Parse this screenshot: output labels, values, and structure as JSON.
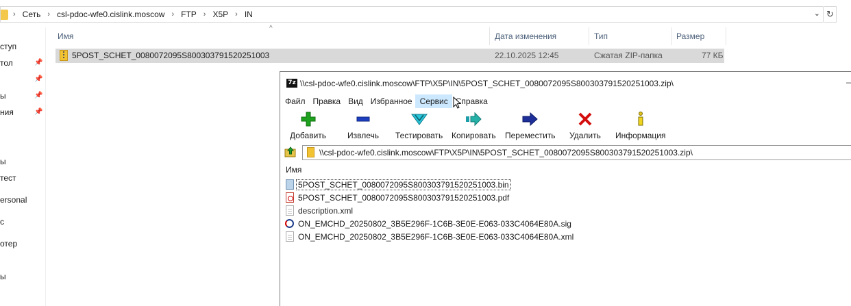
{
  "explorer": {
    "breadcrumbs": [
      "Сеть",
      "csl-pdoc-wfe0.cislink.moscow",
      "FTP",
      "X5P",
      "IN"
    ],
    "columns": {
      "name": "Имя",
      "modified": "Дата изменения",
      "type": "Тип",
      "size": "Размер"
    },
    "nav_items": [
      "ступ",
      "тол",
      "ы",
      "ния",
      "ы",
      "тест",
      "ersonal",
      "с",
      "отер",
      "ы"
    ],
    "file": {
      "name": "5POST_SCHET_0080072095S800303791520251003",
      "modified": "22.10.2025 12:45",
      "type": "Сжатая ZIP-папка",
      "size": "77 КБ"
    }
  },
  "sevenzip": {
    "title": "\\\\csl-pdoc-wfe0.cislink.moscow\\FTP\\X5P\\IN\\5POST_SCHET_0080072095S800303791520251003.zip\\",
    "logo": "7z",
    "menu": [
      "Файл",
      "Правка",
      "Вид",
      "Избранное",
      "Сервис",
      "Справка"
    ],
    "toolbar": [
      "Добавить",
      "Извлечь",
      "Тестировать",
      "Копировать",
      "Переместить",
      "Удалить",
      "Информация"
    ],
    "path": "\\\\csl-pdoc-wfe0.cislink.moscow\\FTP\\X5P\\IN\\5POST_SCHET_0080072095S800303791520251003.zip\\",
    "list_header": "Имя",
    "files": [
      {
        "name": "5POST_SCHET_0080072095S800303791520251003.bin",
        "icon": "bin-file-icon"
      },
      {
        "name": "5POST_SCHET_0080072095S800303791520251003.pdf",
        "icon": "pdf-file-icon"
      },
      {
        "name": "description.xml",
        "icon": "xml-file-icon"
      },
      {
        "name": "ON_EMCHD_20250802_3B5E296F-1C6B-3E0E-E063-033C4064E80A.sig",
        "icon": "signature-file-icon"
      },
      {
        "name": "ON_EMCHD_20250802_3B5E296F-1C6B-3E0E-E063-033C4064E80A.xml",
        "icon": "xml-file-icon"
      }
    ]
  },
  "colors": {
    "selection": "#d9d9d9",
    "menu_hover": "#cce8ff",
    "header_text": "#4c607a"
  }
}
